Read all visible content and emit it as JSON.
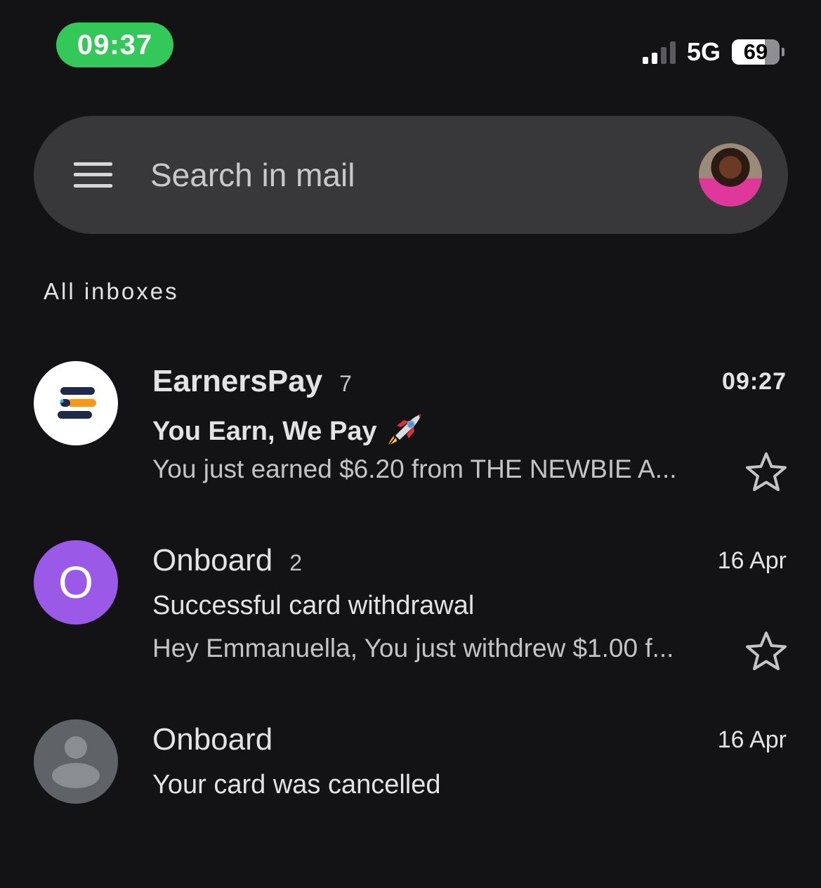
{
  "status_bar": {
    "time": "09:37",
    "network": "5G",
    "battery": "69",
    "battery_fraction": 0.69,
    "signal_bars_active": 2,
    "signal_bars_total": 4
  },
  "search": {
    "placeholder": "Search in mail",
    "menu_icon": "hamburger-menu-icon",
    "avatar_icon": "profile-avatar"
  },
  "section_label": "All inboxes",
  "emails": [
    {
      "sender": "EarnersPay",
      "count": "7",
      "date": "09:27",
      "subject": "You Earn, We Pay",
      "subject_emoji": "rocket-emoji",
      "snippet": "You just earned $6.20 from THE NEWBIE A...",
      "unread": true,
      "avatar_icon": "earnerspay-logo",
      "star_icon": "star-outline-icon"
    },
    {
      "sender": "Onboard",
      "count": "2",
      "date": "16 Apr",
      "subject": "Successful card withdrawal",
      "snippet": "Hey Emmanuella, You just withdrew $1.00 f...",
      "unread": false,
      "avatar_letter": "O",
      "avatar_color": "#9b59e8",
      "star_icon": "star-outline-icon"
    },
    {
      "sender": "Onboard",
      "date": "16 Apr",
      "subject": "Your card was cancelled",
      "unread": false,
      "avatar_icon": "default-person-icon",
      "avatar_color": "#5f6368"
    }
  ],
  "colors": {
    "background": "#131316",
    "search_bar": "#38383b",
    "time_pill": "#34c759"
  }
}
